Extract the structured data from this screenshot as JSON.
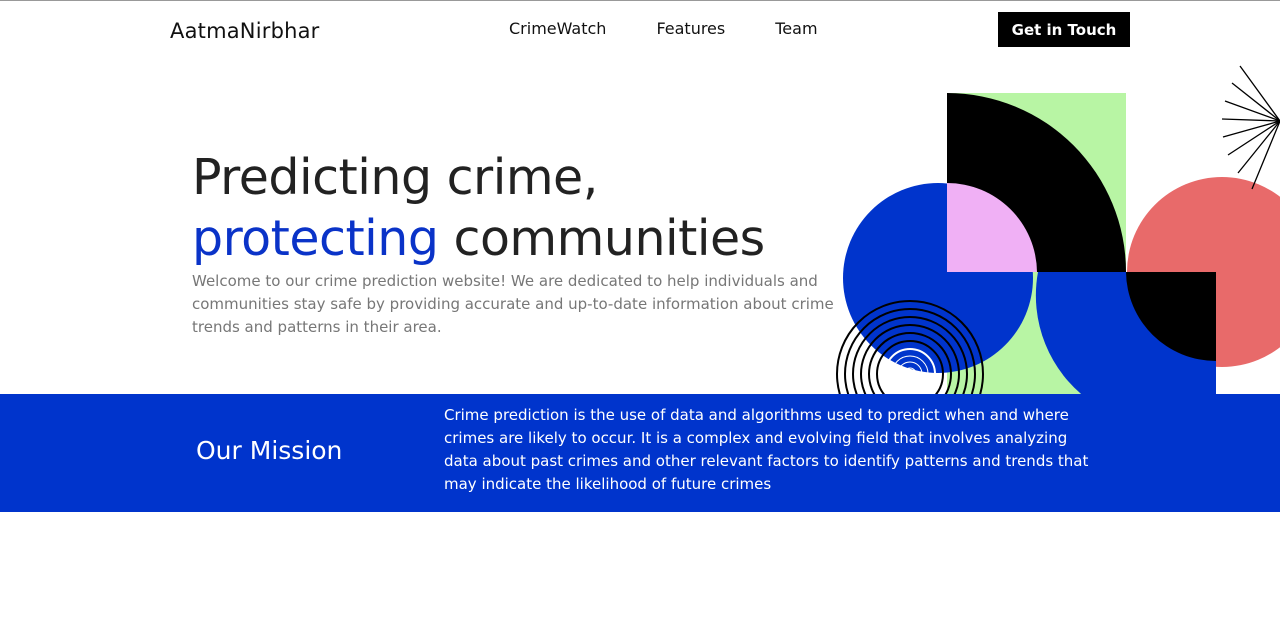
{
  "header": {
    "brand": "AatmaNirbhar",
    "nav": [
      "CrimeWatch",
      "Features",
      "Team"
    ],
    "cta_label": "Get in Touch"
  },
  "hero": {
    "headline_line1": "Predicting crime,",
    "headline_accent": "protecting",
    "headline_rest": " communities",
    "lead": "Welcome to our crime prediction website! We are dedicated to help individuals and communities stay safe by providing accurate and up-to-date information about crime trends and patterns in their area."
  },
  "mission": {
    "title": "Our Mission",
    "text": "Crime prediction is the use of data and algorithms used to predict when and where crimes are likely to occur. It is a complex and evolving field that involves analyzing data about past crimes and other relevant factors to identify patterns and trends that may indicate the likelihood of future crimes"
  },
  "colors": {
    "accent_blue": "#0034cc",
    "light_green": "#b8f5a4",
    "pink": "#f0b0f5",
    "coral": "#e86a6a",
    "black": "#000000"
  },
  "icons": [
    "sunburst-decoration",
    "concentric-circles-decoration"
  ]
}
